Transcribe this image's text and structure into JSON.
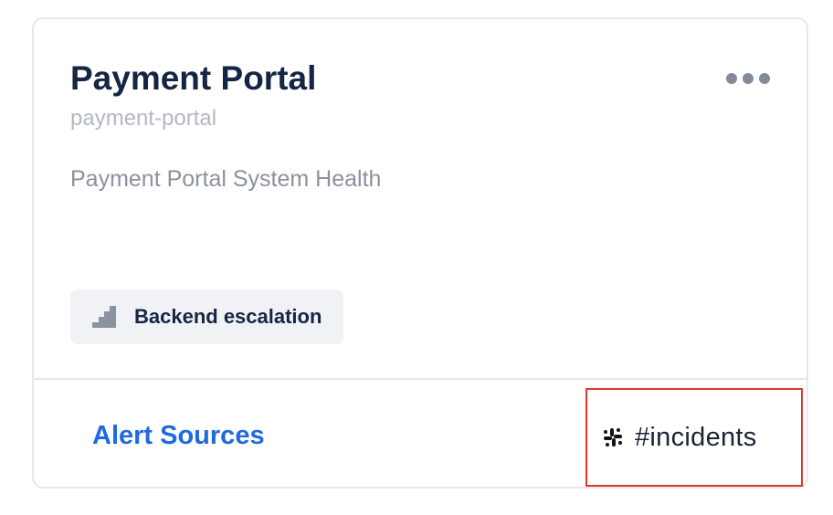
{
  "card": {
    "title": "Payment Portal",
    "slug": "payment-portal",
    "description": "Payment Portal System Health",
    "escalation_policy": {
      "label": "Backend escalation",
      "icon": "stairs-icon"
    },
    "menu_icon": "more-horizontal-icon",
    "footer": {
      "alert_sources_label": "Alert Sources",
      "channel": {
        "label": "#incidents",
        "icon": "slack-icon"
      }
    }
  },
  "colors": {
    "title": "#152544",
    "slug": "#b3b8c4",
    "description": "#8b919e",
    "link": "#1f6ae0",
    "tag_bg": "#f1f2f5",
    "highlight_border": "#e3382a",
    "border": "#e6e8ee"
  }
}
